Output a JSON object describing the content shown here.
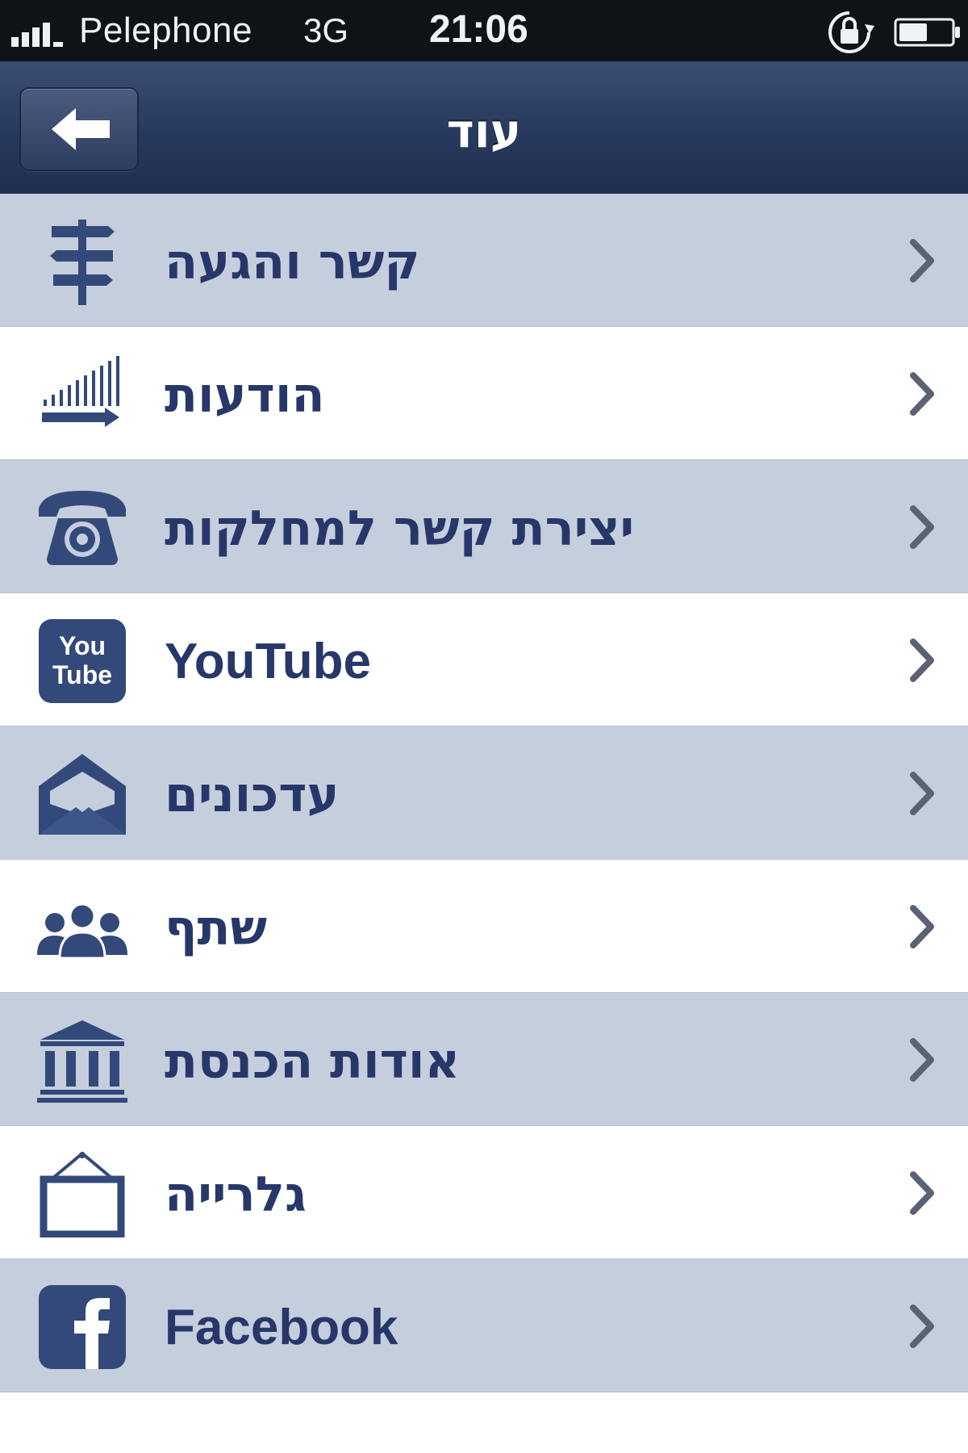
{
  "status_bar": {
    "carrier": "Pelephone",
    "network": "3G",
    "time": "21:06"
  },
  "nav": {
    "title": "עוד"
  },
  "menu": {
    "items": [
      {
        "label": "קשר והגעה",
        "icon": "signpost-icon"
      },
      {
        "label": "הודעות",
        "icon": "announcements-arrow-icon"
      },
      {
        "label": "יצירת קשר למחלקות",
        "icon": "telephone-icon"
      },
      {
        "label": "YouTube",
        "icon": "youtube-icon",
        "icon_text_top": "You",
        "icon_text_bottom": "Tube"
      },
      {
        "label": "עדכונים",
        "icon": "envelope-icon"
      },
      {
        "label": "שתף",
        "icon": "people-icon"
      },
      {
        "label": "אודות הכנסת",
        "icon": "building-icon"
      },
      {
        "label": "גלרייה",
        "icon": "picture-frame-icon"
      },
      {
        "label": "Facebook",
        "icon": "facebook-icon"
      }
    ]
  },
  "colors": {
    "nav_bar": "#27395d",
    "row_shaded": "#c5cedd",
    "row_light": "#ffffff",
    "label_text": "#27376a",
    "icon": "#33497a"
  }
}
